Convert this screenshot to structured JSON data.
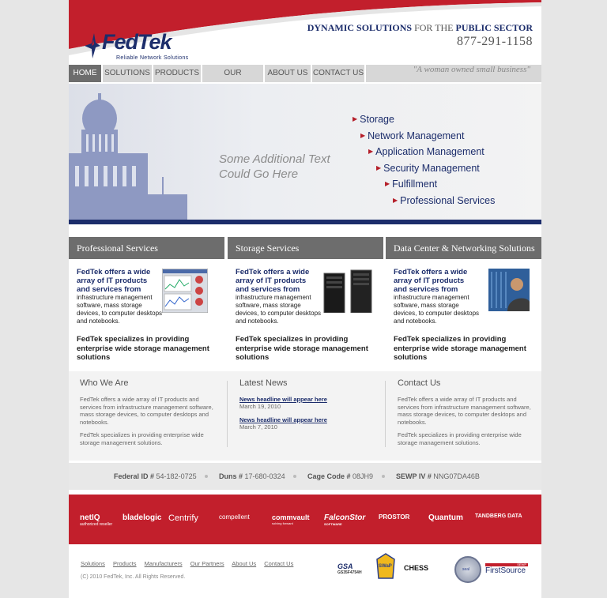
{
  "brand": {
    "name": "FedTek",
    "tagline": "Reliable Network Solutions",
    "headline_a": "DYNAMIC SOLUTIONS ",
    "headline_b": "FOR THE ",
    "headline_c": "PUBLIC SECTOR",
    "phone": "877-291-1158",
    "colors": {
      "navy": "#1c2d6b",
      "red": "#c21f2c",
      "gray": "#6d6d6d"
    }
  },
  "nav": {
    "items": [
      {
        "label": "HOME",
        "active": true
      },
      {
        "label": "SOLUTIONS"
      },
      {
        "label": "PRODUCTS"
      },
      {
        "label": "OUR PARTNERS"
      },
      {
        "label": "ABOUT US"
      },
      {
        "label": "CONTACT US"
      }
    ],
    "motto": "\"A woman owned small business\""
  },
  "hero": {
    "text": "Some Additional Text Could Go Here",
    "links": [
      "Storage",
      "Network Management",
      "Application Management",
      "Security Management",
      "Fulfillment",
      "Professional Services"
    ]
  },
  "columns": [
    {
      "title": "Professional Services",
      "lead": "FedTek offers a wide array of IT products and services from",
      "sub": "infrastructure management software, mass storage devices, to computer desktops and notebooks.",
      "strong": "FedTek specializes in providing enterprise wide storage management solutions",
      "image_icon": "software-screenshot-icon"
    },
    {
      "title": "Storage Services",
      "lead": "FedTek offers a wide array of IT products and services from",
      "sub": "infrastructure management software, mass storage devices, to computer desktops and notebooks.",
      "strong": "FedTek specializes in providing enterprise wide storage management solutions",
      "image_icon": "server-rack-icon"
    },
    {
      "title": "Data Center & Networking Solutions",
      "lead": "FedTek offers a wide array of IT products and services from",
      "sub": "infrastructure management software, mass storage devices, to computer desktops and notebooks.",
      "strong": "FedTek specializes in providing enterprise wide storage management solutions",
      "image_icon": "technician-photo-icon"
    }
  ],
  "info": {
    "who": {
      "title": "Who We Are",
      "p1": "FedTek offers a wide array of IT products and services from infrastructure management software, mass storage devices, to computer desktops and notebooks.",
      "p2": "FedTek specializes in providing enterprise wide storage management solutions."
    },
    "news": {
      "title": "Latest News",
      "items": [
        {
          "headline": "News headline will appear here",
          "date": "March 19, 2010"
        },
        {
          "headline": "News headline will appear here",
          "date": "March 7, 2010"
        }
      ]
    },
    "contact": {
      "title": "Contact Us",
      "p1": "FedTek offers a wide array of IT products and services from infrastructure management software, mass storage devices, to computer desktops and notebooks.",
      "p2": "FedTek specializes in providing enterprise wide storage management solutions."
    }
  },
  "ids": [
    {
      "label": "Federal ID #",
      "value": "54-182-0725"
    },
    {
      "label": "Duns #",
      "value": "17-680-0324"
    },
    {
      "label": "Cage Code #",
      "value": "08JH9"
    },
    {
      "label": "SEWP IV #",
      "value": "NNG07DA46B"
    }
  ],
  "partners": [
    "netIQ",
    "bladelogic",
    "Centrify",
    "compellent",
    "commvault",
    "FalconStor",
    "PROSTOR",
    "Quantum",
    "TANDBERG DATA"
  ],
  "partner_sublabels": {
    "netiq": "authorized reseller",
    "commvault": "solving forward",
    "falconstor": "SOFTWARE"
  },
  "footer": {
    "links": [
      "Solutions",
      "Products",
      "Manufacturers",
      "Our Partners",
      "About Us",
      "Contact Us"
    ],
    "copyright": "(C) 2010 FedTek, Inc. All Rights Reserved.",
    "certs": [
      "GSA",
      "SWaP",
      "CHESS",
      "seal",
      "FirstSource"
    ],
    "cert_sublabels": {
      "gsa": "GS35F4754H",
      "firstsource": "SEWP"
    }
  }
}
